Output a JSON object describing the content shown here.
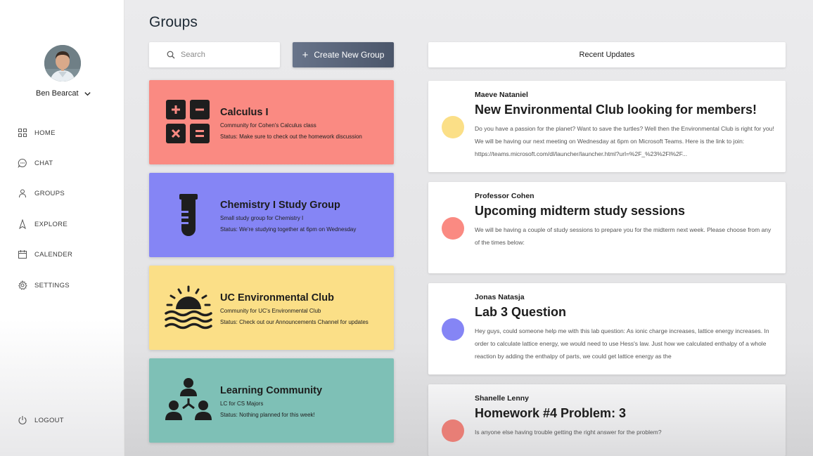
{
  "sidebar": {
    "user_name": "Ben Bearcat",
    "nav": [
      {
        "label": "HOME",
        "icon": "grid-icon"
      },
      {
        "label": "CHAT",
        "icon": "chat-bubble-icon"
      },
      {
        "label": "GROUPS",
        "icon": "person-icon"
      },
      {
        "label": "EXPLORE",
        "icon": "compass-icon"
      },
      {
        "label": "CALENDER",
        "icon": "calendar-icon"
      },
      {
        "label": "SETTINGS",
        "icon": "gear-icon"
      }
    ],
    "logout_label": "LOGOUT"
  },
  "main": {
    "title": "Groups",
    "search_placeholder": "Search",
    "create_button_label": "Create New Group"
  },
  "groups": [
    {
      "name": "Calculus I",
      "description": "Community for Cohen's Calculus class",
      "status": "Status: Make sure to check out the homework discussion",
      "color": "#fa8a82",
      "icon": "calculator-icon"
    },
    {
      "name": "Chemistry I Study Group",
      "description": "Small study group for Chemistry I",
      "status": "Status: We're studying together at 6pm on Wednesday",
      "color": "#8585f5",
      "icon": "test-tube-icon"
    },
    {
      "name": "UC Environmental Club",
      "description": "Community for UC's Environmental Club",
      "status": "Status: Check out our Announcements Channel for updates",
      "color": "#fbdf87",
      "icon": "sunset-icon"
    },
    {
      "name": "Learning Community",
      "description": "LC for CS Majors",
      "status": "Status: Nothing planned for this week!",
      "color": "#7ec0b6",
      "icon": "community-icon"
    }
  ],
  "updates": {
    "header": "Recent Updates",
    "items": [
      {
        "author": "Maeve Nataniel",
        "title": "New Environmental Club looking for members!",
        "body": "Do you have a passion for the planet? Want to save the turtles? Well then the Environmental Club is right for you! We will be having our next meeting on Wednesday at 6pm on Microsoft Teams. Here is the link to join: https://teams.microsoft.com/dl/launcher/launcher.html?url=%2F_%23%2Fl%2F...",
        "dot_color": "#fbdf87"
      },
      {
        "author": "Professor Cohen",
        "title": "Upcoming midterm study sessions",
        "body": "We will be having a couple of study sessions to prepare you for the midterm next week. Please choose from any of the times below:",
        "dot_color": "#fa8a82"
      },
      {
        "author": "Jonas Natasja",
        "title": "Lab 3 Question",
        "body": "Hey guys, could someone help me with this lab question: As ionic charge increases, lattice energy increases. In order to calculate lattice energy, we would need to use Hess's law. Just how we calculated enthalpy of a whole reaction by adding the enthalpy of parts, we could get lattice energy as the",
        "dot_color": "#8585f5"
      },
      {
        "author": "Shanelle Lenny",
        "title": "Homework #4 Problem: 3",
        "body": "Is anyone else having trouble getting the right answer for the problem?",
        "dot_color": "#e87e76"
      }
    ]
  }
}
